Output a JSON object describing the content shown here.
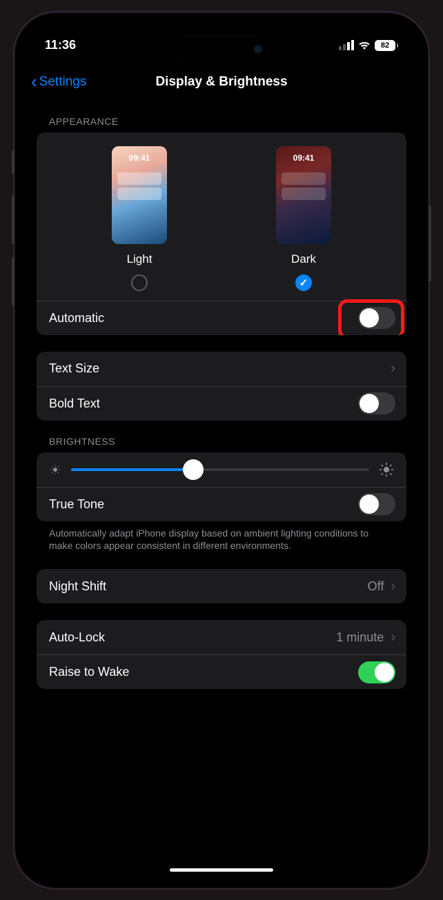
{
  "status_bar": {
    "time": "11:36",
    "battery_percent": "82",
    "signal_bars_filled": 2,
    "wifi_active": true
  },
  "nav": {
    "back_label": "Settings",
    "title": "Display & Brightness"
  },
  "appearance": {
    "section_title": "APPEARANCE",
    "light_label": "Light",
    "dark_label": "Dark",
    "preview_time": "09:41",
    "selected": "dark",
    "automatic_label": "Automatic",
    "automatic_on": false
  },
  "text_group": {
    "text_size_label": "Text Size",
    "bold_text_label": "Bold Text",
    "bold_text_on": false
  },
  "brightness": {
    "section_title": "BRIGHTNESS",
    "level_percent": 41,
    "true_tone_label": "True Tone",
    "true_tone_on": false,
    "footer": "Automatically adapt iPhone display based on ambient lighting conditions to make colors appear consistent in different environments."
  },
  "night_shift": {
    "label": "Night Shift",
    "value": "Off"
  },
  "auto_lock": {
    "label": "Auto-Lock",
    "value": "1 minute"
  },
  "raise_to_wake": {
    "label": "Raise to Wake",
    "on": true
  },
  "highlight": {
    "target": "automatic-toggle"
  }
}
